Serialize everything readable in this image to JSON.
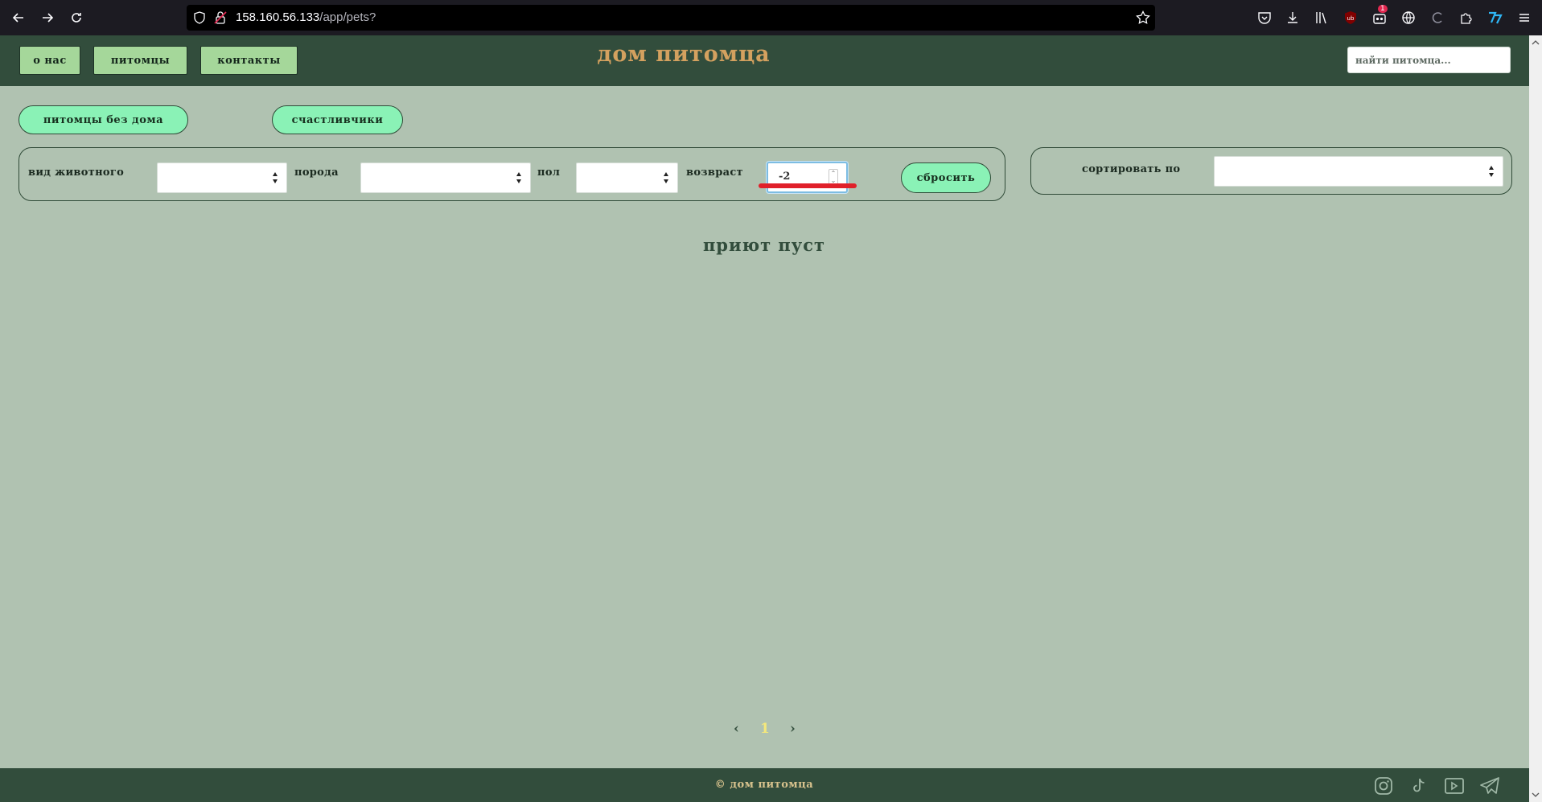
{
  "browser": {
    "url_host": "158.160.56.133",
    "url_path": "/app/pets?",
    "extension_badge": "1"
  },
  "header": {
    "nav": [
      {
        "label": "О НАС"
      },
      {
        "label": "ПИТОМЦЫ"
      },
      {
        "label": "КОНТАКТЫ"
      }
    ],
    "title": "ДОМ ПИТОМЦА",
    "search_placeholder": "найти питомца..."
  },
  "tabs": [
    {
      "label": "ПИТОМЦЫ БЕЗ ДОМА"
    },
    {
      "label": "СЧАСТЛИВЧИКИ"
    }
  ],
  "filters": {
    "species_label": "ВИД ЖИВОТНОГО",
    "species_value": "",
    "breed_label": "ПОРОДА",
    "breed_value": "",
    "sex_label": "ПОЛ",
    "sex_value": "",
    "age_label": "ВОЗВРАСТ",
    "age_value": "-2",
    "reset_label": "СБРОСИТЬ"
  },
  "sort": {
    "label": "СОРТИРОВАТЬ ПО",
    "value": ""
  },
  "main": {
    "empty_message": "приют пуст"
  },
  "pagination": {
    "prev": "‹",
    "current": "1",
    "next": "›"
  },
  "footer": {
    "copyright": "© ДОМ ПИТОМЦА",
    "social": [
      "instagram-icon",
      "tiktok-icon",
      "youtube-icon",
      "telegram-icon"
    ]
  },
  "colors": {
    "page_bg": "#b0c2b1",
    "header_bg": "#324d3c",
    "title": "#d4a15f",
    "pill_bg": "#8af2b6",
    "nav_button_bg": "#a5d79a",
    "annotation_red": "#e0202a"
  }
}
